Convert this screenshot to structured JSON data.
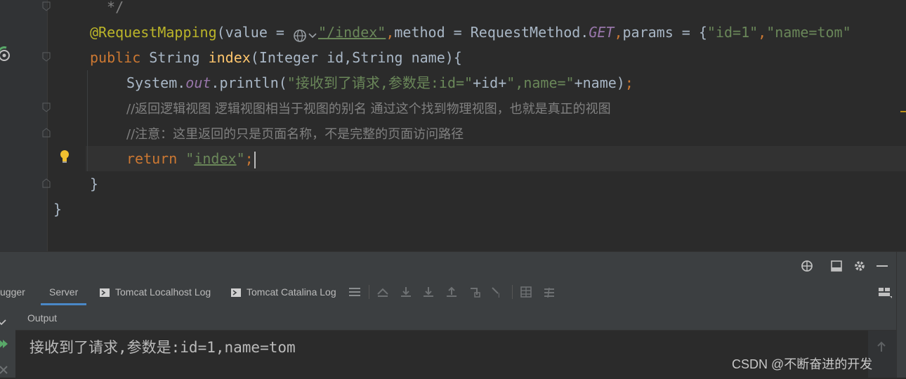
{
  "editor": {
    "lines": {
      "comment_end": " */",
      "annotation": "@RequestMapping",
      "paren_value": "(value = ",
      "url": "\"/index\"",
      "comma1": ",",
      "method_kw": "method = RequestMethod.",
      "get": "GET",
      "comma2": ",",
      "params": "params = {",
      "p1": "\"id=1\"",
      "comma3": ",",
      "p2": "\"name=tom\"",
      "public_kw": "public",
      "string_type": " String ",
      "index_fn": "index",
      "sig_rest": "(Integer id,String name){",
      "sys": "System.",
      "out": "out",
      "println": ".println(",
      "println_str": "\"接收到了请求,参数是:id=\"",
      "plus_id": "+id+",
      "println_str2": "\",name=\"",
      "plus_name": "+name)",
      "semi": ";",
      "comment1": "//返回逻辑视图 逻辑视图相当于视图的别名 通过这个找到物理视图，也就是真正的视图",
      "comment2": "//注意：这里返回的只是页面名称，不是完整的页面访问路径",
      "return_kw": "return ",
      "ret_q1": "\"",
      "ret_val": "index",
      "ret_q2": "\"",
      "ret_semi": ";",
      "close1": "}",
      "close2": "}"
    }
  },
  "tool_window": {
    "tabs": [
      "ugger",
      "Server",
      "Tomcat Localhost Log",
      "Tomcat Catalina Log"
    ],
    "active_tab": "Server",
    "output_label": "Output",
    "console_output": "接收到了请求,参数是:id=1,name=tom"
  },
  "watermark": "CSDN @不断奋进的开发",
  "colors": {
    "background": "#2b2b2b",
    "keyword": "#cc7832",
    "string": "#6a8759",
    "annotation": "#bbb529",
    "function": "#ffc66d",
    "field": "#9876aa",
    "comment": "#808080"
  }
}
